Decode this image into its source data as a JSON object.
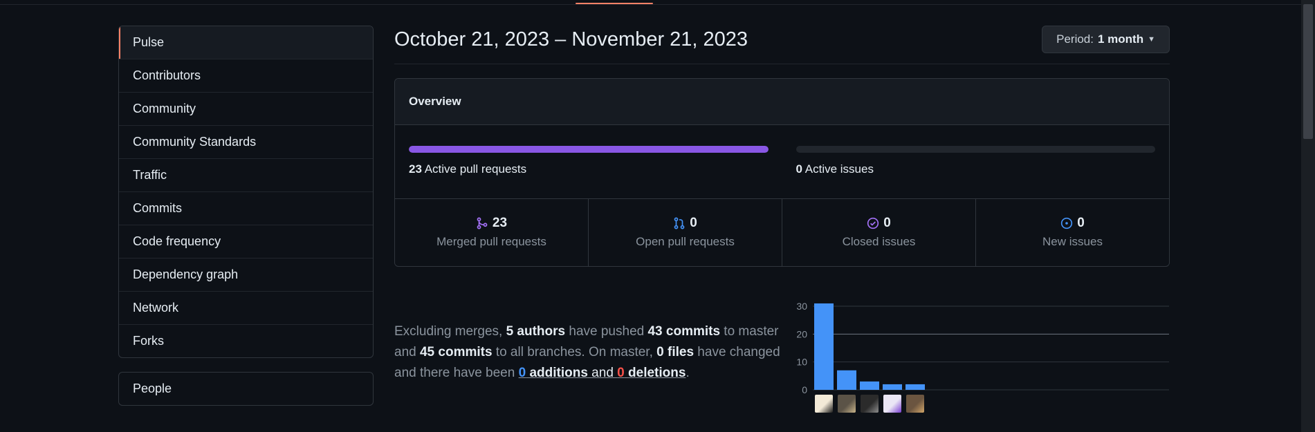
{
  "sidebar": {
    "items": [
      {
        "label": "Pulse",
        "selected": true
      },
      {
        "label": "Contributors"
      },
      {
        "label": "Community"
      },
      {
        "label": "Community Standards"
      },
      {
        "label": "Traffic"
      },
      {
        "label": "Commits"
      },
      {
        "label": "Code frequency"
      },
      {
        "label": "Dependency graph"
      },
      {
        "label": "Network"
      },
      {
        "label": "Forks"
      }
    ],
    "people_label": "People"
  },
  "header": {
    "date_range": "October 21, 2023 – November 21, 2023",
    "period_prefix": "Period:",
    "period_value": "1 month"
  },
  "overview": {
    "title": "Overview",
    "active_prs": {
      "count": "23",
      "label": "Active pull requests",
      "fill_fraction": 1.0,
      "color": "#8957e5"
    },
    "active_issues": {
      "count": "0",
      "label": "Active issues",
      "fill_fraction": 0.0
    },
    "stats": [
      {
        "count": "23",
        "label": "Merged pull requests",
        "icon": "merged-pr-icon",
        "color": "#a371f7"
      },
      {
        "count": "0",
        "label": "Open pull requests",
        "icon": "open-pr-icon",
        "color": "#4493f8"
      },
      {
        "count": "0",
        "label": "Closed issues",
        "icon": "closed-issue-icon",
        "color": "#a371f7"
      },
      {
        "count": "0",
        "label": "New issues",
        "icon": "open-issue-icon",
        "color": "#4493f8"
      }
    ]
  },
  "summary": {
    "t1": "Excluding merges, ",
    "authors": "5 authors",
    "t2": " have pushed ",
    "commits_master": "43 commits",
    "t3": " to master and ",
    "commits_all": "45 commits",
    "t4": " to all branches. On master, ",
    "files": "0 files",
    "t5": " have changed and there have been ",
    "additions_num": "0",
    "additions_word": " additions",
    "and": " and ",
    "deletions_num": "0",
    "deletions_word": " deletions",
    "end": "."
  },
  "chart_data": {
    "type": "bar",
    "categories": [
      "author-1",
      "author-2",
      "author-3",
      "author-4",
      "author-5"
    ],
    "values": [
      31,
      7,
      3,
      2,
      2
    ],
    "ylim": [
      0,
      30
    ],
    "yticks": [
      "30",
      "20",
      "10",
      "0"
    ],
    "grid": true,
    "bar_color": "#4493f8"
  }
}
